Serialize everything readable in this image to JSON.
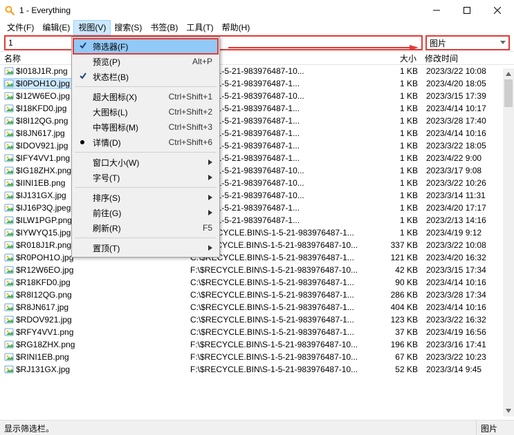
{
  "window": {
    "title": "1 - Everything"
  },
  "menubar": {
    "items": [
      {
        "label": "文件(F)"
      },
      {
        "label": "编辑(E)"
      },
      {
        "label": "视图(V)"
      },
      {
        "label": "搜索(S)"
      },
      {
        "label": "书签(B)"
      },
      {
        "label": "工具(T)"
      },
      {
        "label": "帮助(H)"
      }
    ],
    "open_index": 2
  },
  "dropdown": {
    "items": [
      {
        "label": "筛选器(F)",
        "hl": true,
        "check": true,
        "boxed": true
      },
      {
        "label": "预览(P)",
        "hotkey": "Alt+P"
      },
      {
        "label": "状态栏(B)",
        "check": true
      },
      {
        "sep": true
      },
      {
        "label": "超大图标(X)",
        "hotkey": "Ctrl+Shift+1"
      },
      {
        "label": "大图标(L)",
        "hotkey": "Ctrl+Shift+2"
      },
      {
        "label": "中等图标(M)",
        "hotkey": "Ctrl+Shift+3"
      },
      {
        "label": "详情(D)",
        "hotkey": "Ctrl+Shift+6",
        "bullet": true
      },
      {
        "sep": true
      },
      {
        "label": "窗口大小(W)",
        "sub": true
      },
      {
        "label": "字号(T)",
        "sub": true
      },
      {
        "sep": true
      },
      {
        "label": "排序(S)",
        "sub": true
      },
      {
        "label": "前往(G)",
        "sub": true
      },
      {
        "label": "刷新(R)",
        "hotkey": "F5"
      },
      {
        "sep": true
      },
      {
        "label": "置顶(T)",
        "sub": true
      }
    ]
  },
  "search": {
    "value": "1"
  },
  "filter": {
    "value": "图片"
  },
  "columns": {
    "name": "名称",
    "path": "",
    "size": "大小",
    "date": "修改时间"
  },
  "rows": [
    {
      "name": "$I018J1R.png",
      "path": ".BIN\\S-1-5-21-983976487-10...",
      "size": "1 KB",
      "date": "2023/3/22 10:08"
    },
    {
      "name": "$I0POH1O.jpg",
      "path": ".BIN\\S-1-5-21-983976487-1...",
      "size": "1 KB",
      "date": "2023/4/20 18:05",
      "sel": true
    },
    {
      "name": "$I12W6EO.jpg",
      "path": ".BIN\\S-1-5-21-983976487-10...",
      "size": "1 KB",
      "date": "2023/3/15 17:39"
    },
    {
      "name": "$I18KFD0.jpg",
      "path": ".BIN\\S-1-5-21-983976487-1...",
      "size": "1 KB",
      "date": "2023/4/14 10:17"
    },
    {
      "name": "$I8I12QG.png",
      "path": ".BIN\\S-1-5-21-983976487-1...",
      "size": "1 KB",
      "date": "2023/3/28 17:40"
    },
    {
      "name": "$I8JN617.jpg",
      "path": ".BIN\\S-1-5-21-983976487-1...",
      "size": "1 KB",
      "date": "2023/4/14 10:16"
    },
    {
      "name": "$IDOV921.jpg",
      "path": ".BIN\\S-1-5-21-983976487-1...",
      "size": "1 KB",
      "date": "2023/3/22 18:05"
    },
    {
      "name": "$IFY4VV1.png",
      "path": ".BIN\\S-1-5-21-983976487-1...",
      "size": "1 KB",
      "date": "2023/4/22 9:00"
    },
    {
      "name": "$IG18ZHX.png",
      "path": ".BIN\\S-1-5-21-983976487-10...",
      "size": "1 KB",
      "date": "2023/3/17 9:08"
    },
    {
      "name": "$IINI1EB.png",
      "path": ".BIN\\S-1-5-21-983976487-10...",
      "size": "1 KB",
      "date": "2023/3/22 10:26"
    },
    {
      "name": "$IJ131GX.jpg",
      "path": ".BIN\\S-1-5-21-983976487-10...",
      "size": "1 KB",
      "date": "2023/3/14 11:31"
    },
    {
      "name": "$IJ16P3Q.jpeg",
      "path": ".BIN\\S-1-5-21-983976487-1...",
      "size": "1 KB",
      "date": "2023/4/20 17:17"
    },
    {
      "name": "$ILW1PGP.png",
      "path": ".BIN\\S-1-5-21-983976487-1...",
      "size": "1 KB",
      "date": "2023/2/13 14:16"
    },
    {
      "name": "$IYWYQ15.jpg",
      "path": "C:\\$RECYCLE.BIN\\S-1-5-21-983976487-1...",
      "size": "1 KB",
      "date": "2023/4/19 9:12"
    },
    {
      "name": "$R018J1R.png",
      "path": "F:\\$RECYCLE.BIN\\S-1-5-21-983976487-10...",
      "size": "337 KB",
      "date": "2023/3/22 10:08"
    },
    {
      "name": "$R0POH1O.jpg",
      "path": "C:\\$RECYCLE.BIN\\S-1-5-21-983976487-1...",
      "size": "121 KB",
      "date": "2023/4/20 16:32"
    },
    {
      "name": "$R12W6EO.jpg",
      "path": "F:\\$RECYCLE.BIN\\S-1-5-21-983976487-10...",
      "size": "42 KB",
      "date": "2023/3/15 17:34"
    },
    {
      "name": "$R18KFD0.jpg",
      "path": "C:\\$RECYCLE.BIN\\S-1-5-21-983976487-1...",
      "size": "90 KB",
      "date": "2023/4/14 10:16"
    },
    {
      "name": "$R8I12QG.png",
      "path": "C:\\$RECYCLE.BIN\\S-1-5-21-983976487-1...",
      "size": "286 KB",
      "date": "2023/3/28 17:34"
    },
    {
      "name": "$R8JN617.jpg",
      "path": "C:\\$RECYCLE.BIN\\S-1-5-21-983976487-1...",
      "size": "404 KB",
      "date": "2023/4/14 10:16"
    },
    {
      "name": "$RDOV921.jpg",
      "path": "C:\\$RECYCLE.BIN\\S-1-5-21-983976487-1...",
      "size": "123 KB",
      "date": "2023/3/22 16:32"
    },
    {
      "name": "$RFY4VV1.png",
      "path": "C:\\$RECYCLE.BIN\\S-1-5-21-983976487-1...",
      "size": "37 KB",
      "date": "2023/4/19 16:56"
    },
    {
      "name": "$RG18ZHX.png",
      "path": "F:\\$RECYCLE.BIN\\S-1-5-21-983976487-10...",
      "size": "196 KB",
      "date": "2023/3/16 17:41"
    },
    {
      "name": "$RINI1EB.png",
      "path": "F:\\$RECYCLE.BIN\\S-1-5-21-983976487-10...",
      "size": "67 KB",
      "date": "2023/3/22 10:23"
    },
    {
      "name": "$RJ131GX.jpg",
      "path": "F:\\$RECYCLE.BIN\\S-1-5-21-983976487-10...",
      "size": "52 KB",
      "date": "2023/3/14 9:45"
    }
  ],
  "status": {
    "left": "显示筛选栏。",
    "right": "图片"
  }
}
